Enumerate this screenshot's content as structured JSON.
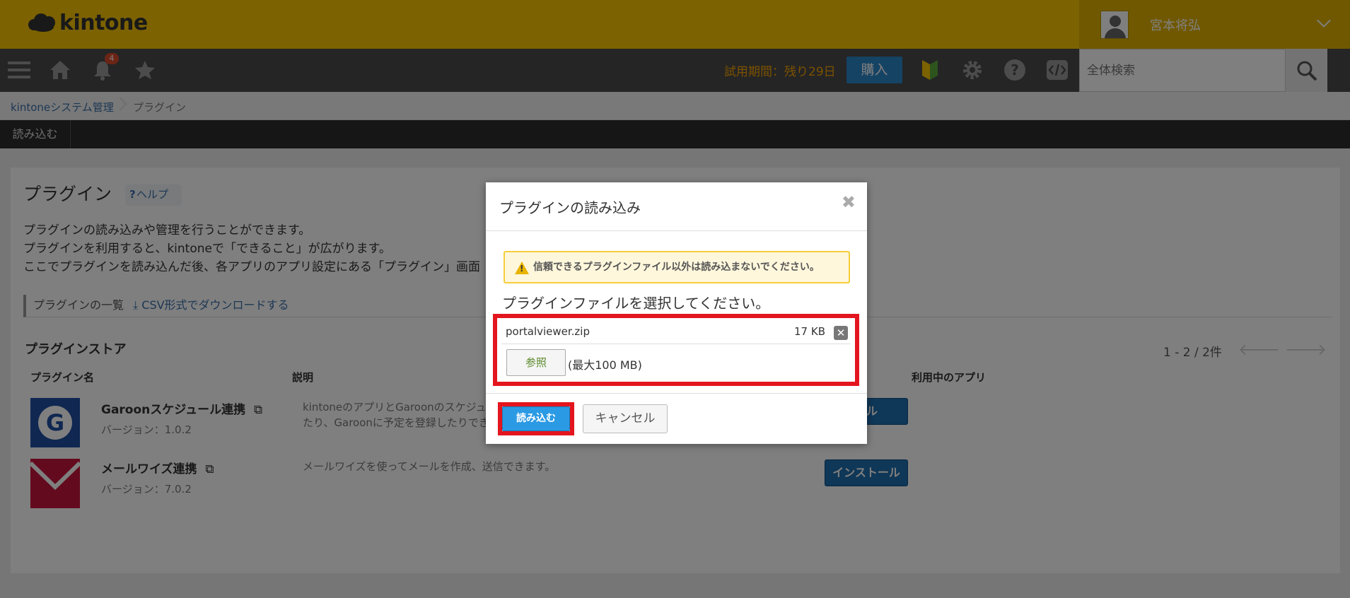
{
  "header": {
    "logo_text": "kintone",
    "user_name": "宮本将弘"
  },
  "toolbar": {
    "notification_count": "4",
    "trial_text": "試用期間：残り29日",
    "buy_label": "購入",
    "search_placeholder": "全体検索"
  },
  "breadcrumb": {
    "items": [
      "kintoneシステム管理",
      "プラグイン"
    ]
  },
  "tabs": [
    "読み込む"
  ],
  "main": {
    "title": "プラグイン",
    "help_label": "ヘルプ",
    "description": [
      "プラグインの読み込みや管理を行うことができます。",
      "プラグインを利用すると、kintoneで「できること」が広がります。",
      "ここでプラグインを読み込んだ後、各アプリのアプリ設定にある「プラグイン」画面"
    ],
    "list_header": "プラグインの一覧",
    "csv_link": "CSV形式でダウンロードする",
    "store_title": "プラグインストア",
    "pager": "1 - 2 / 2件",
    "columns": [
      "プラグイン名",
      "説明",
      "利用中のアプリ"
    ],
    "plugins": [
      {
        "name": "Garoonスケジュール連携",
        "version": "バージョン：1.0.2",
        "description_1": "kintoneのアプリとGaroonのスケジュー",
        "description_2": "たり、Garoonに予定を登録したりできま",
        "install_label": "ール",
        "icon_color": "#1f4ea3"
      },
      {
        "name": "メールワイズ連携",
        "version": "バージョン：7.0.2",
        "description_1": "メールワイズを使ってメールを作成、送信できます。",
        "install_label": "インストール",
        "icon_color": "#c8143c"
      }
    ]
  },
  "dialog": {
    "title": "プラグインの読み込み",
    "warning": "信頼できるプラグインファイル以外は読み込まないでください。",
    "select_text": "プラグインファイルを選択してください。",
    "file_name": "portalviewer.zip",
    "file_size": "17 KB",
    "browse_label": "参照",
    "max_size": "(最大100 MB)",
    "import_label": "読み込む",
    "cancel_label": "キャンセル"
  },
  "colors": {
    "header_yellow": "#f8c500",
    "highlight_red": "#e3151e",
    "primary_blue": "#2b9ae4"
  }
}
